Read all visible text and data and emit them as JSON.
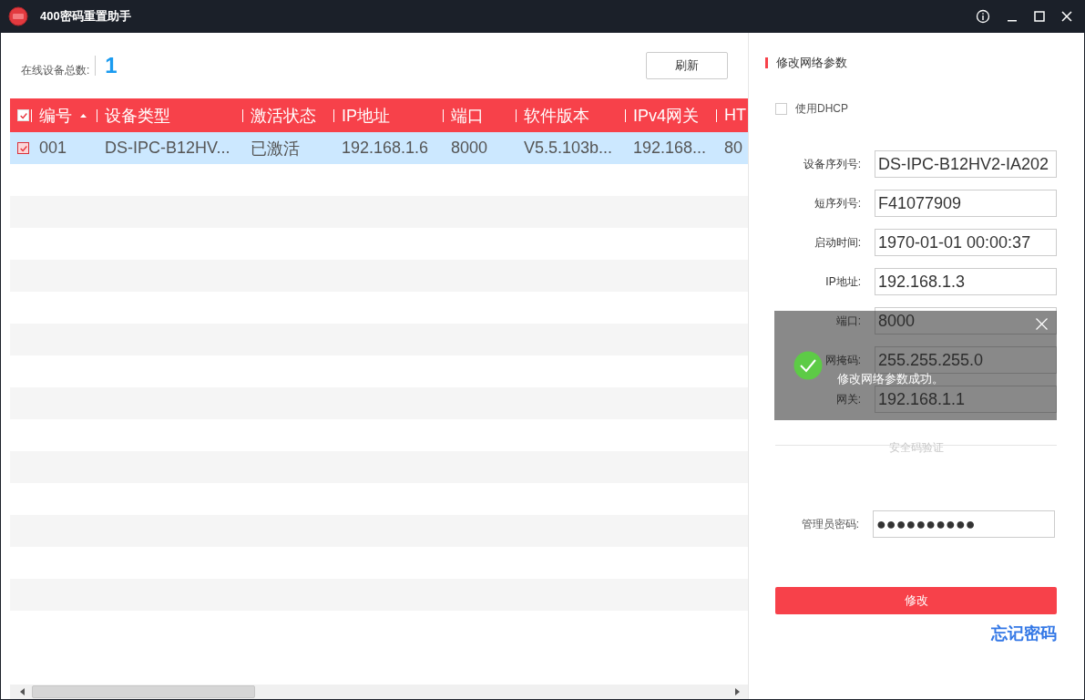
{
  "window": {
    "title": "400密码重置助手"
  },
  "device_count": {
    "label": "在线设备总数:",
    "value": "1"
  },
  "refresh_button": "刷新",
  "table": {
    "header_checked": true,
    "columns": [
      {
        "label": "编号",
        "sorted": true
      },
      {
        "label": "设备类型",
        "sorted": false
      },
      {
        "label": "激活状态",
        "sorted": false
      },
      {
        "label": "IP地址",
        "sorted": false
      },
      {
        "label": "端口",
        "sorted": false
      },
      {
        "label": "软件版本",
        "sorted": false
      },
      {
        "label": "IPv4网关",
        "sorted": false
      },
      {
        "label": "HT",
        "sorted": false
      }
    ],
    "rows": [
      {
        "selected": true,
        "checked": true,
        "cells": [
          "001",
          "DS-IPC-B12HV...",
          "已激活",
          "192.168.1.6",
          "8000",
          "V5.5.103b...",
          "192.168...",
          "80"
        ]
      }
    ]
  },
  "panel": {
    "title": "修改网络参数",
    "dhcp": {
      "label": "使用DHCP",
      "checked": false
    },
    "fields": [
      {
        "label": "设备序列号:",
        "value": "DS-IPC-B12HV2-IA202"
      },
      {
        "label": "短序列号:",
        "value": "F41077909"
      },
      {
        "label": "启动时间:",
        "value": "1970-01-01 00:00:37"
      },
      {
        "label": "IP地址:",
        "value": "192.168.1.3"
      },
      {
        "label": "端口:",
        "value": "8000"
      },
      {
        "label": "网掩码:",
        "value": "255.255.255.0"
      },
      {
        "label": "网关:",
        "value": "192.168.1.1"
      }
    ],
    "section": "安全码验证",
    "password": {
      "label": "管理员密码:",
      "value": "●●●●●●●●●●"
    },
    "submit": "修改",
    "forgot_link": "忘记密码"
  },
  "toast": {
    "kind": "success",
    "message": "修改网络参数成功。"
  }
}
